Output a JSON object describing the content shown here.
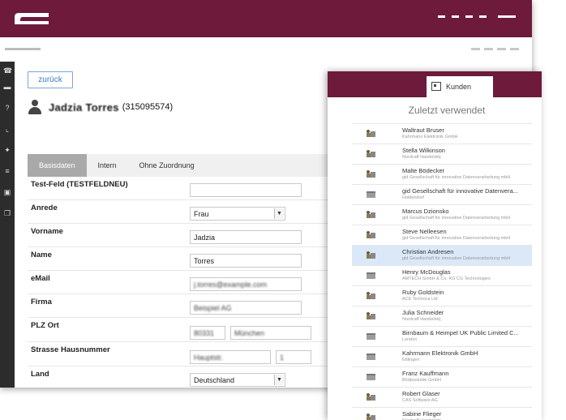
{
  "back_window": {
    "back_button": "zurück",
    "person": {
      "name": "Jadzia Torres",
      "id": "(315095574)"
    },
    "tabs": [
      "Basisdaten",
      "Intern",
      "Ohne Zuordnung"
    ],
    "fields": {
      "testfeld": {
        "label": "Test-Feld (TESTFELDNEU)",
        "value": ""
      },
      "anrede": {
        "label": "Anrede",
        "value": "Frau"
      },
      "vorname": {
        "label": "Vorname",
        "value": "Jadzia"
      },
      "name": {
        "label": "Name",
        "value": "Torres"
      },
      "email": {
        "label": "eMail",
        "value": "j.torres@example.com"
      },
      "firma": {
        "label": "Firma",
        "value": "Beispiel AG"
      },
      "plz_ort": {
        "label": "PLZ Ort",
        "plz": "80331",
        "ort": "München"
      },
      "strasse": {
        "label": "Strasse Hausnummer",
        "strasse": "Hauptstr.",
        "nr": "1"
      },
      "land": {
        "label": "Land",
        "value": "Deutschland"
      }
    }
  },
  "front_window": {
    "tab_label": "Kunden",
    "recent_title": "Zuletzt verwendet",
    "items": [
      {
        "name": "Waltraut Bruser",
        "sub": "Kahrmann Elektronik GmbH",
        "icon": "person-icon"
      },
      {
        "name": "Stella Wilkinson",
        "sub": "Nordcaff Handelskij",
        "icon": "person-icon"
      },
      {
        "name": "Malte Bödecker",
        "sub": "gid Gesellschaft für innovative Datenverarbeitung mbH",
        "icon": "person-icon"
      },
      {
        "name": "gid Gesellschaft für innovative Datenvera...",
        "sub": "Holdendorf",
        "icon": "company-icon"
      },
      {
        "name": "Marcus Dzionsko",
        "sub": "gid Gesellschaft für innovative Datenverarbeitung mbH",
        "icon": "person-icon"
      },
      {
        "name": "Steve Nelleesen",
        "sub": "gid Gesellschaft für innovative Datenverarbeitung mbH",
        "icon": "person-icon"
      },
      {
        "name": "Christian Andresen",
        "sub": "gid Gesellschaft für innovative Datenverarbeitung mbH",
        "icon": "person-icon",
        "highlight": true
      },
      {
        "name": "Henry McDouglas",
        "sub": "AMTECH GmbH & Co. KG CG Technologies",
        "icon": "company-icon"
      },
      {
        "name": "Ruby Goldstein",
        "sub": "ACE Technica Ltd",
        "icon": "person-icon"
      },
      {
        "name": "Julia Schneider",
        "sub": "Nordcaff Handelskij",
        "icon": "person-icon"
      },
      {
        "name": "Birnbaum & Heimpel UK Public Limited C...",
        "sub": "London",
        "icon": "company-icon"
      },
      {
        "name": "Kahrmann Elektronik GmbH",
        "sub": "Ettlingen",
        "icon": "company-icon"
      },
      {
        "name": "Franz Kauffmann",
        "sub": "Bödpostulde GmbH",
        "icon": "company-icon"
      },
      {
        "name": "Robert Glaser",
        "sub": "CAS Software AG",
        "icon": "person-icon"
      },
      {
        "name": "Sabine Flieger",
        "sub": "Nordcaff Handelskij",
        "icon": "person-icon"
      }
    ]
  },
  "colors": {
    "brand": "#6d1a3b",
    "highlight": "#dbe8f7",
    "link": "#3c7ac2"
  }
}
